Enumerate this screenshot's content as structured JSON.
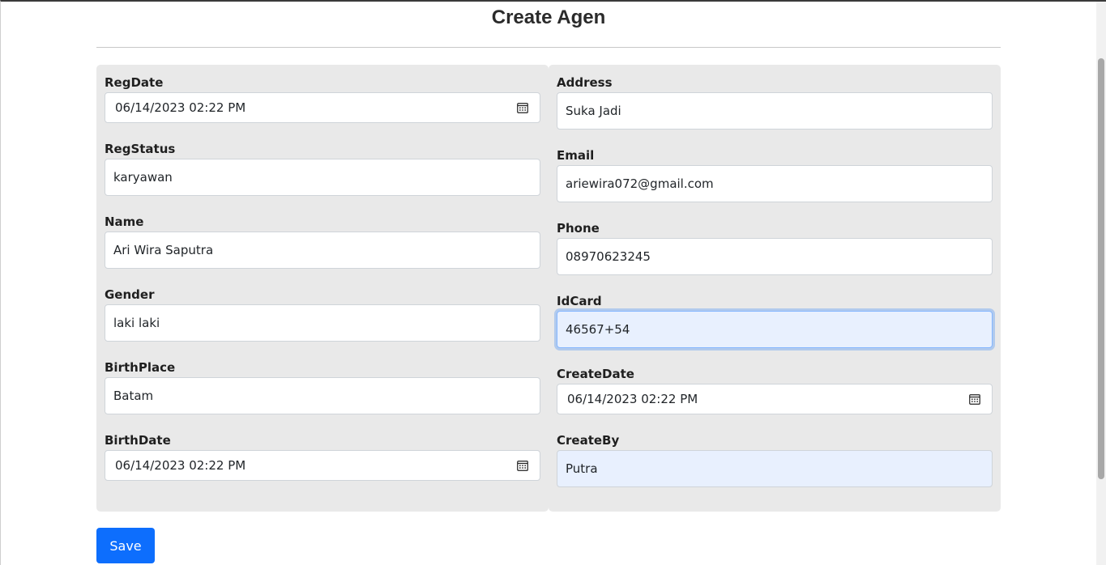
{
  "page": {
    "title": "Create Agen"
  },
  "left_fields": [
    {
      "label": "RegDate",
      "value": "06/14/2023 02:22  PM",
      "type": "datetime"
    },
    {
      "label": "RegStatus",
      "value": "karyawan",
      "type": "text"
    },
    {
      "label": "Name",
      "value": "Ari Wira Saputra",
      "type": "text"
    },
    {
      "label": "Gender",
      "value": "laki laki",
      "type": "text"
    },
    {
      "label": "BirthPlace",
      "value": "Batam",
      "type": "text"
    },
    {
      "label": "BirthDate",
      "value": "06/14/2023 02:22  PM",
      "type": "datetime"
    }
  ],
  "right_fields": [
    {
      "label": "Address",
      "value": "Suka Jadi",
      "type": "text"
    },
    {
      "label": "Email",
      "value": "ariewira072@gmail.com",
      "type": "text"
    },
    {
      "label": "Phone",
      "value": "08970623245",
      "type": "text"
    },
    {
      "label": "IdCard",
      "value": "46567+54",
      "type": "text",
      "state": "focused"
    },
    {
      "label": "CreateDate",
      "value": "06/14/2023 02:22  PM",
      "type": "datetime"
    },
    {
      "label": "CreateBy",
      "value": "Putra",
      "type": "text",
      "state": "autofill"
    }
  ],
  "actions": {
    "save_label": "Save"
  },
  "colors": {
    "primary": "#0d6efd",
    "panel": "#e9e9e9",
    "autofill": "#e8f0fe"
  },
  "icons": {
    "date_picker": "calendar-icon"
  }
}
